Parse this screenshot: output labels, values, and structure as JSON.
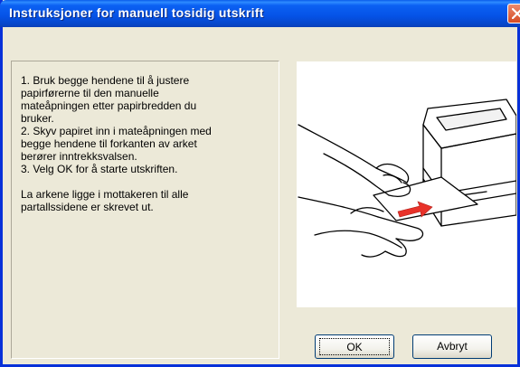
{
  "window": {
    "title": "Instruksjoner for manuell tosidig utskrift"
  },
  "instructions": {
    "text": "1. Bruk begge hendene til å justere\npapirførerne til den manuelle\nmateåpningen etter papirbredden du\nbruker.\n2. Skyv papiret inn i mateåpningen med\nbegge hendene til forkanten av arket\nberører inntrekksvalsen.\n3. Velg OK for å starte utskriften.\n\nLa arkene ligge i mottakeren til alle\npartallssidene er skrevet ut."
  },
  "buttons": {
    "ok_label": "OK",
    "cancel_label": "Avbryt"
  },
  "colors": {
    "titlebar": "#0552e6",
    "dialog_bg": "#ece9d8",
    "close_button": "#d64b23",
    "arrow": "#e8322a"
  },
  "icons": {
    "close": "close-icon",
    "illustration": "printer-manual-feed-illustration"
  }
}
